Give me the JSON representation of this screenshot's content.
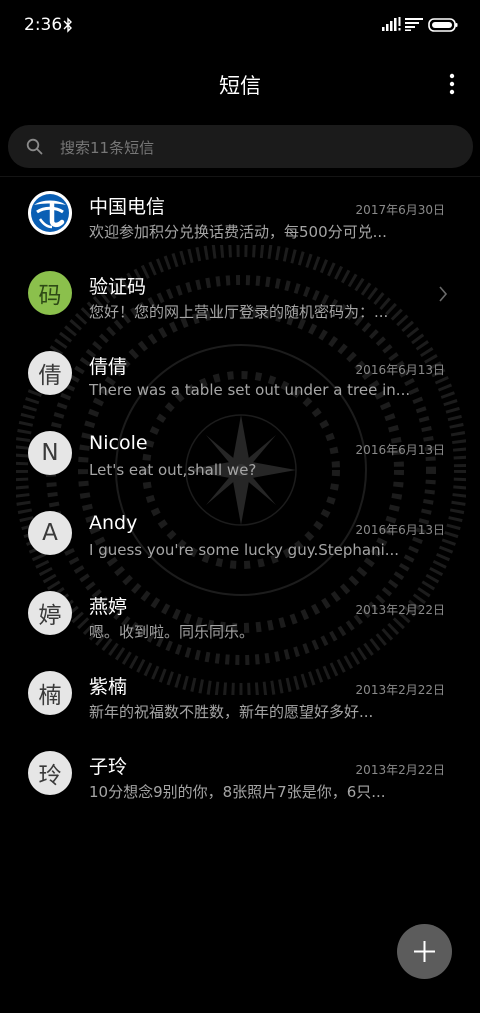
{
  "status_bar": {
    "time": "2:36"
  },
  "header": {
    "title": "短信"
  },
  "search": {
    "placeholder": "搜索11条短信"
  },
  "messages": [
    {
      "avatar": "",
      "avatar_type": "china-telecom-logo",
      "name": "中国电信",
      "date": "2017年6月30日",
      "preview": "欢迎参加积分兑换话费活动，每500分可兑..."
    },
    {
      "avatar": "码",
      "avatar_color": "#8bc04c",
      "name": "验证码",
      "date": "",
      "preview": "您好！您的网上营业厅登录的随机密码为：..."
    },
    {
      "avatar": "倩",
      "name": "倩倩",
      "date": "2016年6月13日",
      "preview": "There was a table set out under a tree in..."
    },
    {
      "avatar": "N",
      "name": "Nicole",
      "date": "2016年6月13日",
      "preview": "Let's eat out,shall we?"
    },
    {
      "avatar": "A",
      "name": "Andy",
      "date": "2016年6月13日",
      "preview": "I guess you're some lucky guy.Stephani..."
    },
    {
      "avatar": "婷",
      "name": "燕婷",
      "date": "2013年2月22日",
      "preview": "嗯。收到啦。同乐同乐。"
    },
    {
      "avatar": "楠",
      "name": "紫楠",
      "date": "2013年2月22日",
      "preview": "新年的祝福数不胜数，新年的愿望好多好..."
    },
    {
      "avatar": "玲",
      "name": "子玲",
      "date": "2013年2月22日",
      "preview": "10分想念9别的你，8张照片7张是你，6只..."
    }
  ]
}
